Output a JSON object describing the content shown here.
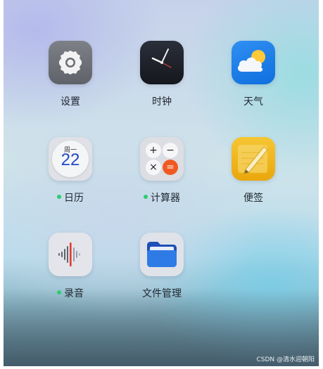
{
  "apps": [
    {
      "label": "设置",
      "notification_dot": false
    },
    {
      "label": "时钟",
      "notification_dot": false
    },
    {
      "label": "天气",
      "notification_dot": false
    },
    {
      "label": "日历",
      "notification_dot": true
    },
    {
      "label": "计算器",
      "notification_dot": true
    },
    {
      "label": "便签",
      "notification_dot": false
    },
    {
      "label": "录音",
      "notification_dot": true
    },
    {
      "label": "文件管理",
      "notification_dot": false
    }
  ],
  "calendar": {
    "weekday": "周一",
    "day": "22"
  },
  "calculator": {
    "keys": [
      "+",
      "−",
      "×",
      "="
    ]
  },
  "icons": [
    "gear-icon",
    "clock-icon",
    "weather-icon",
    "calendar-icon",
    "calculator-icon",
    "notes-icon",
    "recorder-icon",
    "folder-icon"
  ],
  "colors": {
    "notification_dot": "#2ecc71",
    "calendar_day": "#2149c9",
    "calc_equals": "#f05a22",
    "record_bar": "#e53935"
  },
  "watermark": "CSDN @清水迎朝阳"
}
